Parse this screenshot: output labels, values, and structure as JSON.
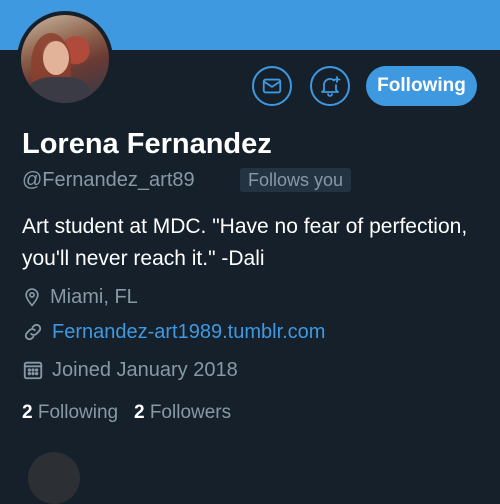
{
  "profile": {
    "display_name": "Lorena Fernandez",
    "handle": "@Fernandez_art89",
    "follows_you_label": "Follows you",
    "bio": "Art student at MDC. \"Have no fear of perfection, you'll never reach it.\" -Dali",
    "location": "Miami, FL",
    "website": "Fernandez-art1989.tumblr.com",
    "joined": "Joined January 2018",
    "following_count": "2",
    "following_label": "Following",
    "followers_count": "2",
    "followers_label": "Followers"
  },
  "actions": {
    "follow_button_label": "Following",
    "message_icon": "mail-icon",
    "notification_icon": "bell-plus-icon"
  },
  "colors": {
    "accent": "#3f99e0",
    "background": "#15202b",
    "muted_text": "#8899a6"
  }
}
